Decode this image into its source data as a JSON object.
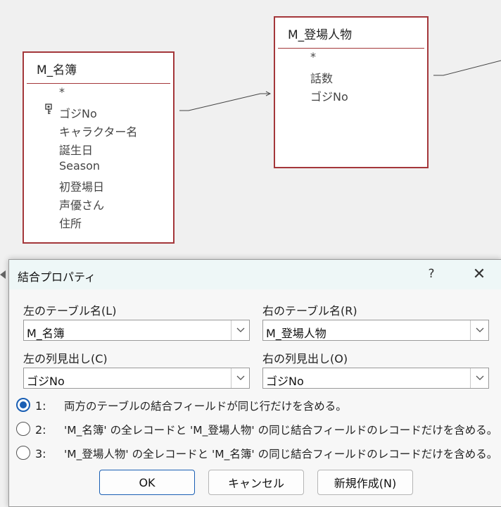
{
  "relationships_canvas": {
    "table_left": {
      "name": "M_名簿",
      "fields": [
        "*",
        "ゴジNo",
        "キャラクター名",
        "誕生日",
        "Season",
        "初登場日",
        "声優さん",
        "住所"
      ],
      "primary_key": "ゴジNo"
    },
    "table_right": {
      "name": "M_登場人物",
      "fields": [
        "*",
        "話数",
        "ゴジNo"
      ]
    }
  },
  "dialog": {
    "title": "結合プロパティ",
    "help_label": "?",
    "close_label": "✕",
    "left_table_label": "左のテーブル名(L)",
    "left_table_value": "M_名簿",
    "right_table_label": "右のテーブル名(R)",
    "right_table_value": "M_登場人物",
    "left_column_label": "左の列見出し(C)",
    "left_column_value": "ゴジNo",
    "right_column_label": "右の列見出し(O)",
    "right_column_value": "ゴジNo",
    "options": [
      {
        "num": "1:",
        "text": "両方のテーブルの結合フィールドが同じ行だけを含める。",
        "selected": true
      },
      {
        "num": "2:",
        "text": "'M_名簿' の全レコードと 'M_登場人物' の同じ結合フィールドのレコードだけを含める。",
        "selected": false
      },
      {
        "num": "3:",
        "text": "'M_登場人物' の全レコードと 'M_名簿' の同じ結合フィールドのレコードだけを含める。",
        "selected": false
      }
    ],
    "buttons": {
      "ok": "OK",
      "cancel": "キャンセル",
      "new": "新規作成(N)"
    }
  },
  "colors": {
    "table_border": "#a4373a",
    "accent": "#1a5fb4",
    "titlebar": "#eef7f7"
  }
}
